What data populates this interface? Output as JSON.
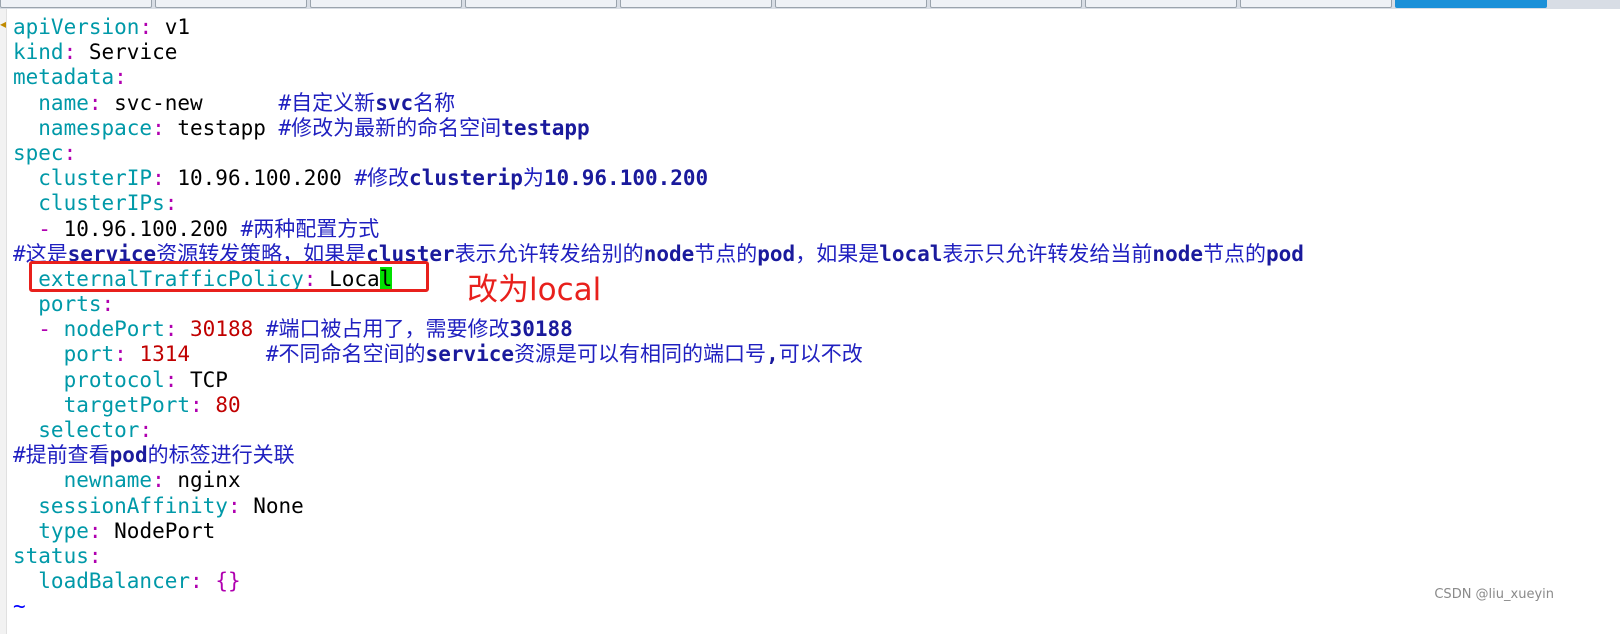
{
  "editor": {
    "lines": [
      [
        {
          "t": "apiVersion",
          "c": "k"
        },
        {
          "t": ":",
          "c": "p"
        },
        {
          "t": " v1",
          "c": "v"
        }
      ],
      [
        {
          "t": "kind",
          "c": "k"
        },
        {
          "t": ":",
          "c": "p"
        },
        {
          "t": " Service",
          "c": "v"
        }
      ],
      [
        {
          "t": "metadata",
          "c": "k"
        },
        {
          "t": ":",
          "c": "p"
        }
      ],
      [
        {
          "t": "  name",
          "c": "k"
        },
        {
          "t": ":",
          "c": "p"
        },
        {
          "t": " svc-new      ",
          "c": "v"
        },
        {
          "t": "#自定义新",
          "c": "c"
        },
        {
          "t": "svc",
          "c": "cb"
        },
        {
          "t": "名称",
          "c": "c"
        }
      ],
      [
        {
          "t": "  namespace",
          "c": "k"
        },
        {
          "t": ":",
          "c": "p"
        },
        {
          "t": " testapp ",
          "c": "v"
        },
        {
          "t": "#修改为最新的命名空间",
          "c": "c"
        },
        {
          "t": "testapp",
          "c": "cb"
        }
      ],
      [
        {
          "t": "spec",
          "c": "k"
        },
        {
          "t": ":",
          "c": "p"
        }
      ],
      [
        {
          "t": "  clusterIP",
          "c": "k"
        },
        {
          "t": ":",
          "c": "p"
        },
        {
          "t": " 10.96.100.200 ",
          "c": "v"
        },
        {
          "t": "#修改",
          "c": "c"
        },
        {
          "t": "clusterip",
          "c": "cb"
        },
        {
          "t": "为",
          "c": "c"
        },
        {
          "t": "10.96.100.200",
          "c": "cb"
        }
      ],
      [
        {
          "t": "  clusterIPs",
          "c": "k"
        },
        {
          "t": ":",
          "c": "p"
        }
      ],
      [
        {
          "t": "  -",
          "c": "p"
        },
        {
          "t": " 10.96.100.200 ",
          "c": "v"
        },
        {
          "t": "#两种配置方式",
          "c": "c"
        }
      ],
      [
        {
          "t": "#这是",
          "c": "c"
        },
        {
          "t": "service",
          "c": "cb"
        },
        {
          "t": "资源转发策略，如果是",
          "c": "c"
        },
        {
          "t": "cluster",
          "c": "cb"
        },
        {
          "t": "表示允许转发给别的",
          "c": "c"
        },
        {
          "t": "node",
          "c": "cb"
        },
        {
          "t": "节点的",
          "c": "c"
        },
        {
          "t": "pod",
          "c": "cb"
        },
        {
          "t": "，如果是",
          "c": "c"
        },
        {
          "t": "local",
          "c": "cb"
        },
        {
          "t": "表示只允许转发给当前",
          "c": "c"
        },
        {
          "t": "node",
          "c": "cb"
        },
        {
          "t": "节点的",
          "c": "c"
        },
        {
          "t": "pod",
          "c": "cb"
        }
      ],
      [
        {
          "t": "  externalTrafficPolicy",
          "c": "k"
        },
        {
          "t": ":",
          "c": "p"
        },
        {
          "t": " Loca",
          "c": "v"
        },
        {
          "t": "l",
          "c": "cursor"
        }
      ],
      [
        {
          "t": "  ports",
          "c": "k"
        },
        {
          "t": ":",
          "c": "p"
        }
      ],
      [
        {
          "t": "  -",
          "c": "p"
        },
        {
          "t": " nodePort",
          "c": "k"
        },
        {
          "t": ":",
          "c": "p"
        },
        {
          "t": " 30188",
          "c": "n"
        },
        {
          "t": " #端口被占用了，需要修改",
          "c": "c"
        },
        {
          "t": "30188",
          "c": "cb"
        }
      ],
      [
        {
          "t": "    port",
          "c": "k"
        },
        {
          "t": ":",
          "c": "p"
        },
        {
          "t": " 1314",
          "c": "n"
        },
        {
          "t": "      #不同命名空间的",
          "c": "c"
        },
        {
          "t": "service",
          "c": "cb"
        },
        {
          "t": "资源是可以有相同的端口号",
          "c": "c"
        },
        {
          "t": ",",
          "c": "cb"
        },
        {
          "t": "可以不改",
          "c": "c"
        }
      ],
      [
        {
          "t": "    protocol",
          "c": "k"
        },
        {
          "t": ":",
          "c": "p"
        },
        {
          "t": " TCP",
          "c": "v"
        }
      ],
      [
        {
          "t": "    targetPort",
          "c": "k"
        },
        {
          "t": ":",
          "c": "p"
        },
        {
          "t": " 80",
          "c": "n"
        }
      ],
      [
        {
          "t": "  selector",
          "c": "k"
        },
        {
          "t": ":",
          "c": "p"
        }
      ],
      [
        {
          "t": "#提前查看",
          "c": "c"
        },
        {
          "t": "pod",
          "c": "cb"
        },
        {
          "t": "的标签进行关联",
          "c": "c"
        }
      ],
      [
        {
          "t": "    newname",
          "c": "k"
        },
        {
          "t": ":",
          "c": "p"
        },
        {
          "t": " nginx",
          "c": "v"
        }
      ],
      [
        {
          "t": "  sessionAffinity",
          "c": "k"
        },
        {
          "t": ":",
          "c": "p"
        },
        {
          "t": " None",
          "c": "v"
        }
      ],
      [
        {
          "t": "  type",
          "c": "k"
        },
        {
          "t": ":",
          "c": "p"
        },
        {
          "t": " NodePort",
          "c": "v"
        }
      ],
      [
        {
          "t": "status",
          "c": "k"
        },
        {
          "t": ":",
          "c": "p"
        }
      ],
      [
        {
          "t": "  loadBalancer",
          "c": "k"
        },
        {
          "t": ":",
          "c": "p"
        },
        {
          "t": " {}",
          "c": "p"
        }
      ],
      [
        {
          "t": "~",
          "c": "tilde"
        }
      ]
    ]
  },
  "annotation": {
    "text": "改为local"
  },
  "watermark": {
    "text": "CSDN @liu_xueyin"
  }
}
